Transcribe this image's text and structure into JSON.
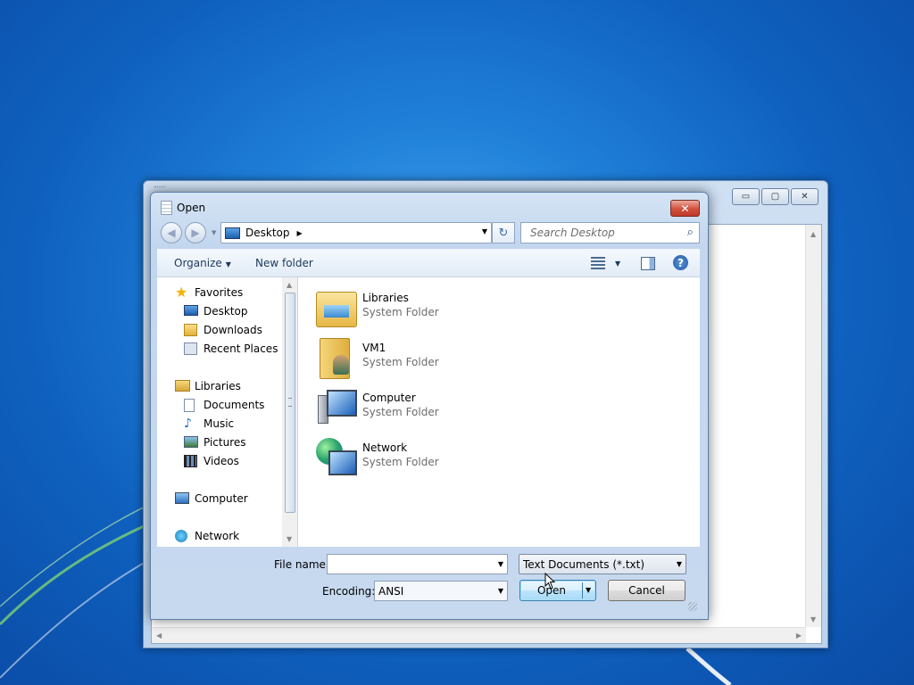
{
  "dialog": {
    "title": "Open",
    "close_glyph": "✕"
  },
  "address": {
    "location": "Desktop",
    "search_placeholder": "Search Desktop"
  },
  "toolbar": {
    "organize_label": "Organize",
    "new_folder_label": "New folder",
    "help_glyph": "?"
  },
  "nav": {
    "favorites_label": "Favorites",
    "favorites": [
      {
        "label": "Desktop",
        "icon": "desktop-icon"
      },
      {
        "label": "Downloads",
        "icon": "downloads-icon"
      },
      {
        "label": "Recent Places",
        "icon": "recent-places-icon"
      }
    ],
    "libraries_label": "Libraries",
    "libraries": [
      {
        "label": "Documents",
        "icon": "documents-icon"
      },
      {
        "label": "Music",
        "icon": "music-icon"
      },
      {
        "label": "Pictures",
        "icon": "pictures-icon"
      },
      {
        "label": "Videos",
        "icon": "videos-icon"
      }
    ],
    "computer_label": "Computer",
    "network_label": "Network"
  },
  "files": [
    {
      "name": "Libraries",
      "type": "System Folder",
      "icon": "libraries-folder-icon"
    },
    {
      "name": "VM1",
      "type": "System Folder",
      "icon": "user-folder-icon"
    },
    {
      "name": "Computer",
      "type": "System Folder",
      "icon": "computer-icon"
    },
    {
      "name": "Network",
      "type": "System Folder",
      "icon": "network-icon"
    }
  ],
  "bottom": {
    "file_name_label": "File name:",
    "file_name_value": "",
    "filter_value": "Text Documents (*.txt)",
    "encoding_label": "Encoding:",
    "encoding_value": "ANSI",
    "open_label": "Open",
    "cancel_label": "Cancel"
  },
  "colors": {
    "desktop_blue": "#1f7fd8",
    "dialog_frame": "#c2d6ee",
    "close_red": "#d1503a"
  }
}
